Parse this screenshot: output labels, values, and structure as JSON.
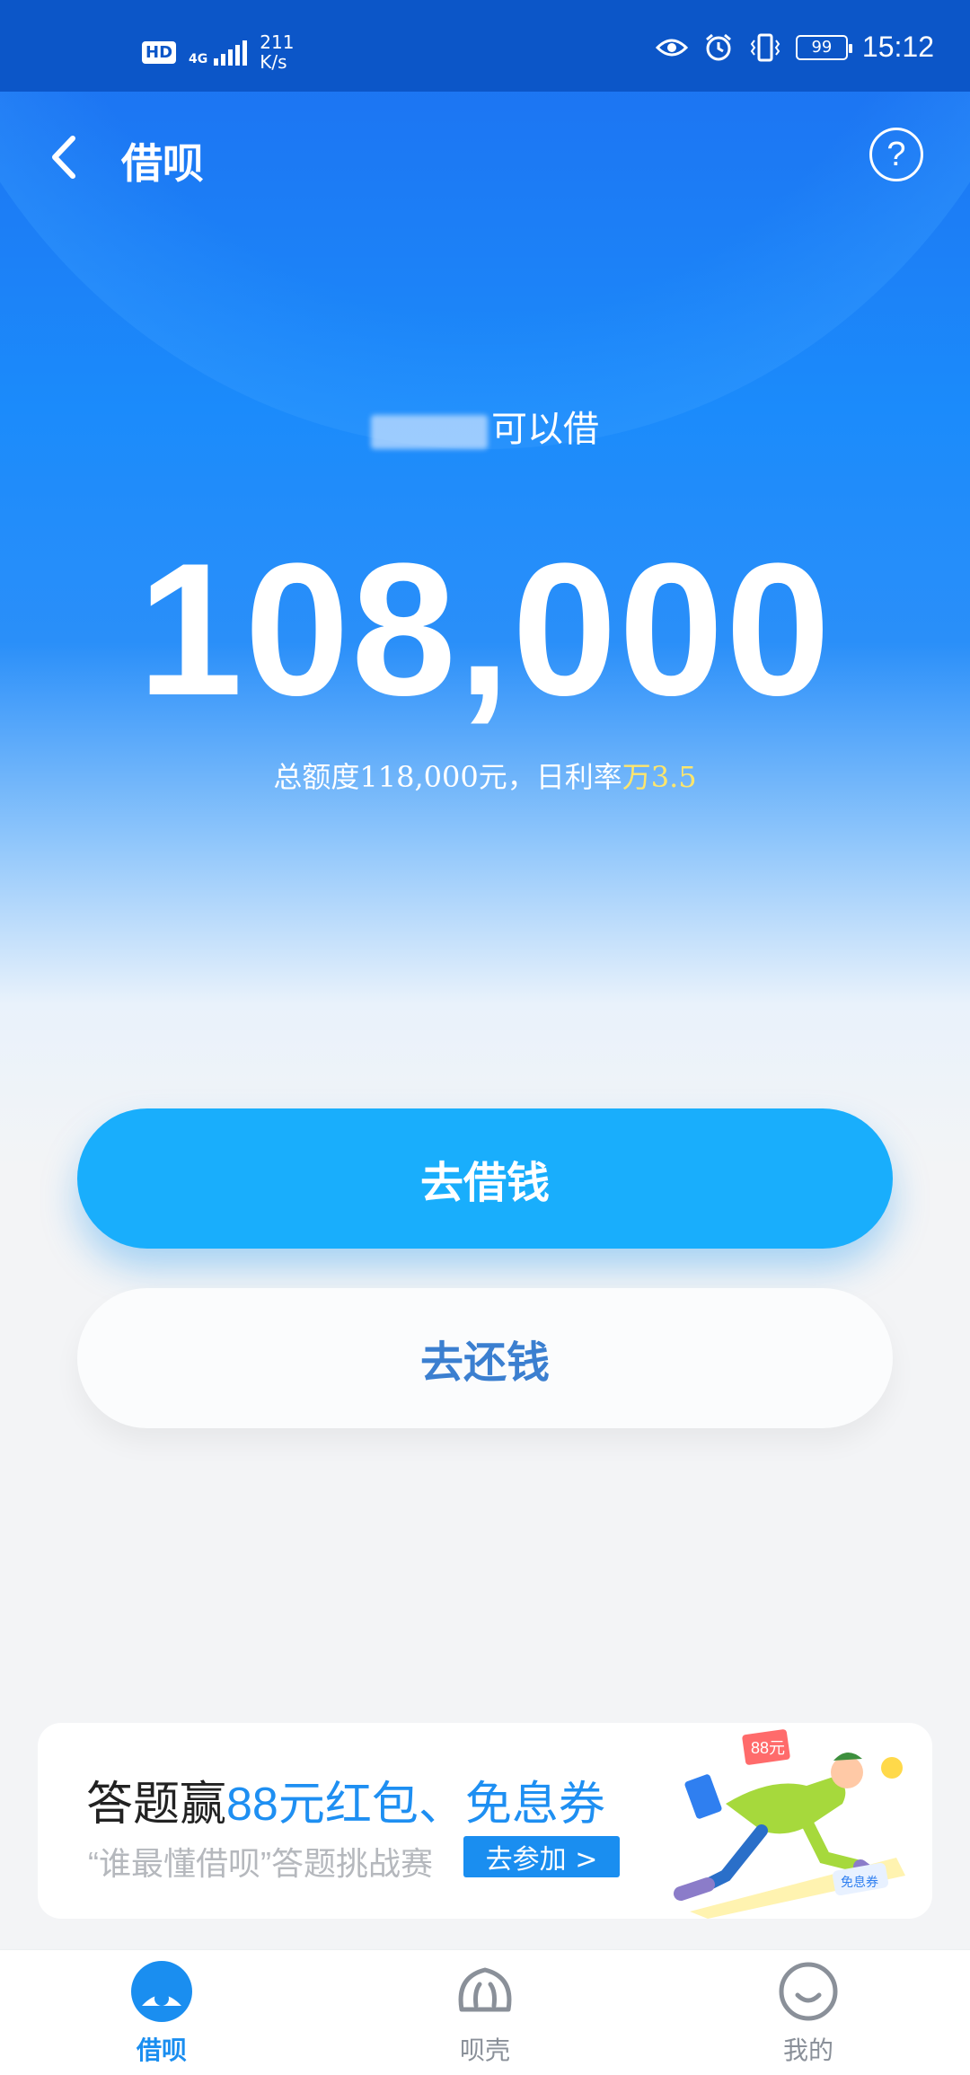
{
  "status_bar": {
    "hd": "HD",
    "network": "4G",
    "speed_value": "211",
    "speed_unit": "K/s",
    "battery": "99",
    "time": "15:12"
  },
  "nav": {
    "title": "借呗"
  },
  "hero": {
    "borrow_label": "可以借",
    "amount": "108,000",
    "quota_prefix": "总额度118,000元，日利率",
    "rate": "万3.5"
  },
  "actions": {
    "borrow_label": "去借钱",
    "repay_label": "去还钱"
  },
  "banner": {
    "title_prefix": "答题赢",
    "title_highlight": "88元红包、免息券",
    "subtitle": "“谁最懂借呗”答题挑战赛",
    "join_label": "去参加 >",
    "art_tag": "88元",
    "art_coupon": "免息券"
  },
  "tabs": [
    {
      "label": "借呗",
      "icon": "jiebei-icon",
      "active": true
    },
    {
      "label": "呗壳",
      "icon": "shell-icon",
      "active": false
    },
    {
      "label": "我的",
      "icon": "smile-icon",
      "active": false
    }
  ],
  "colors": {
    "primary": "#19aefc",
    "status_bar": "#0c56c8",
    "accent_blue": "#1a8ef0",
    "rate_yellow": "#ffe66b"
  }
}
